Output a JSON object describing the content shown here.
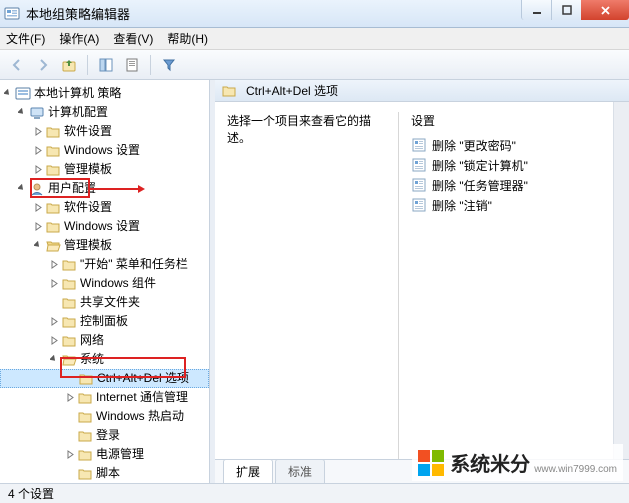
{
  "window": {
    "title": "本地组策略编辑器"
  },
  "menus": {
    "file": "文件(F)",
    "action": "操作(A)",
    "view": "查看(V)",
    "help": "帮助(H)"
  },
  "tree": {
    "root": "本地计算机 策略",
    "computer_config": "计算机配置",
    "cc_sw": "软件设置",
    "cc_win": "Windows 设置",
    "cc_admin": "管理模板",
    "user_config": "用户配置",
    "uc_sw": "软件设置",
    "uc_win": "Windows 设置",
    "uc_admin": "管理模板",
    "start_taskbar": "\"开始\" 菜单和任务栏",
    "win_comp": "Windows 组件",
    "shared": "共享文件夹",
    "ctrlpanel": "控制面板",
    "network": "网络",
    "system": "系统",
    "ctrl_alt_del": "Ctrl+Alt+Del 选项",
    "inet_mgmt": "Internet 通信管理",
    "win_hotstart": "Windows 热启动",
    "login": "登录",
    "power": "电源管理",
    "script": "脚本"
  },
  "right": {
    "header": "Ctrl+Alt+Del 选项",
    "prompt": "选择一个项目来查看它的描述。",
    "col_setting": "设置",
    "items": [
      "删除 \"更改密码\"",
      "删除 \"锁定计算机\"",
      "删除 \"任务管理器\"",
      "删除 \"注销\""
    ],
    "tab_extended": "扩展",
    "tab_standard": "标准"
  },
  "status": "4 个设置"
}
